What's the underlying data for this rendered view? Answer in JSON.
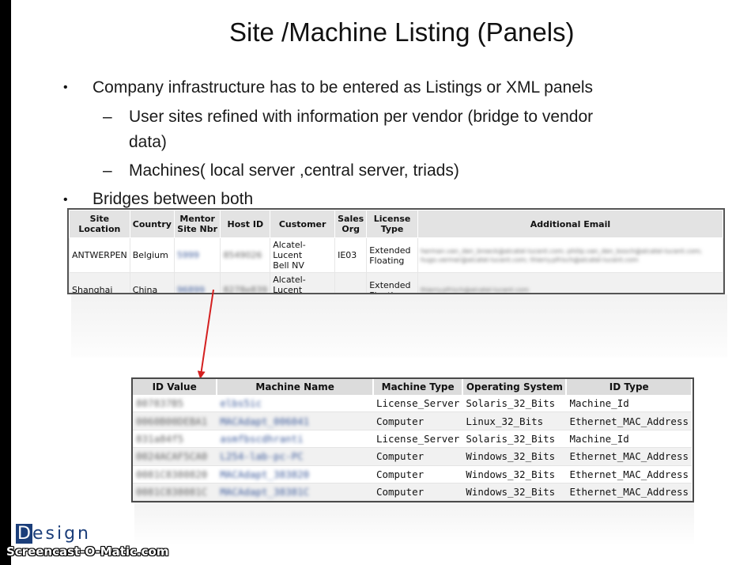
{
  "slide": {
    "title": "Site /Machine Listing (Panels)",
    "bullet1": "Company infrastructure has to be entered as Listings or XML panels",
    "sub1a_line1": "User sites refined with information per vendor (bridge to vendor",
    "sub1a_line2": "data)",
    "sub1b": "Machines( local server ,central server, triads)",
    "bullet2": "Bridges between both",
    "bullet_symbol": "•",
    "dash_symbol": "–"
  },
  "site_table": {
    "headers": [
      "Site\nLocation",
      "Country",
      "Mentor\nSite Nbr",
      "Host ID",
      "Customer",
      "Sales\nOrg",
      "License\nType",
      "Additional Email"
    ],
    "rows": [
      {
        "location": "ANTWERPEN",
        "country": "Belgium",
        "mentor": "5999",
        "hostid": "8549026",
        "customer": "Alcatel-Lucent\nBell NV",
        "sales": "IE03",
        "license": "Extended\nFloating",
        "email": "herman.van_den_broeck@alcatel-lucent.com; philip.van_den_bosch@alcatel-lucent.com; hugo.vermer@alcatel-lucent.com; thierry.pfrisch@alcatel-lucent.com"
      },
      {
        "location": "Shanghai",
        "country": "China",
        "mentor": "96899",
        "hostid": "8278e839",
        "customer": "Alcatel-Lucent\nShanghai",
        "sales": "",
        "license": "Extended\nFloating",
        "email": "thierry.pfrisch@alcatel-lucent.com"
      }
    ]
  },
  "machine_table": {
    "headers": [
      "ID Value",
      "Machine Name",
      "Machine Type",
      "Operating System",
      "ID Type"
    ],
    "rows": [
      {
        "id": "807837B5",
        "name": "elbs5ic",
        "type": "License_Server",
        "os": "Solaris_32_Bits",
        "idtype": "Machine_Id"
      },
      {
        "id": "0060B00DEBA1",
        "name": "MACAdapt_006041",
        "type": "Computer",
        "os": "Linux_32_Bits",
        "idtype": "Ethernet_MAC_Address"
      },
      {
        "id": "831a84f5",
        "name": "asmfbscdhranti",
        "type": "License_Server",
        "os": "Solaris_32_Bits",
        "idtype": "Machine_Id"
      },
      {
        "id": "0024ACAF5CA0",
        "name": "L254-lab-pc-PC",
        "type": "Computer",
        "os": "Windows_32_Bits",
        "idtype": "Ethernet_MAC_Address"
      },
      {
        "id": "0081C8380820",
        "name": "MACAdapt_383820",
        "type": "Computer",
        "os": "Windows_32_Bits",
        "idtype": "Ethernet_MAC_Address"
      },
      {
        "id": "0081C838081C",
        "name": "MACAdapt_38381C",
        "type": "Computer",
        "os": "Windows_32_Bits",
        "idtype": "Ethernet_MAC_Address"
      }
    ]
  },
  "logo": {
    "first": "D",
    "rest": "esign"
  },
  "watermark": "Screencast-O-Matic.com",
  "colors": {
    "arrow": "#d42020",
    "logo": "#1b3e7a"
  }
}
